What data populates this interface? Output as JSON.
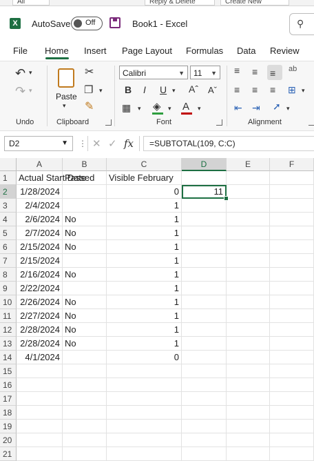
{
  "top_tabs": [
    "All",
    "Reply & Delete",
    "Create New"
  ],
  "title_bar": {
    "autosave_label": "AutoSave",
    "autosave_state": "Off",
    "document_title": "Book1  -  Excel"
  },
  "menu": [
    "File",
    "Home",
    "Insert",
    "Page Layout",
    "Formulas",
    "Data",
    "Review"
  ],
  "ribbon": {
    "groups": [
      "Undo",
      "Clipboard",
      "Font",
      "Alignment"
    ],
    "paste_label": "Paste",
    "font_name": "Calibri",
    "font_size": "11"
  },
  "formula_bar": {
    "name_box": "D2",
    "fx": "fx",
    "formula": "=SUBTOTAL(109, C:C)"
  },
  "grid": {
    "columns": [
      "A",
      "B",
      "C",
      "D",
      "E",
      "F"
    ],
    "rows": [
      "1",
      "2",
      "3",
      "4",
      "5",
      "6",
      "7",
      "8",
      "9",
      "10",
      "11",
      "12",
      "13",
      "14",
      "15",
      "16",
      "17",
      "18",
      "19",
      "20",
      "21"
    ],
    "selected_cell": "D2",
    "cells": [
      [
        "Actual Start Date",
        "Passed",
        "Visible February",
        ""
      ],
      [
        "1/28/2024",
        "",
        "0",
        "11"
      ],
      [
        "2/4/2024",
        "",
        "1",
        ""
      ],
      [
        "2/6/2024",
        "No",
        "1",
        ""
      ],
      [
        "2/7/2024",
        "No",
        "1",
        ""
      ],
      [
        "2/15/2024",
        "No",
        "1",
        ""
      ],
      [
        "2/15/2024",
        "",
        "1",
        ""
      ],
      [
        "2/16/2024",
        "No",
        "1",
        ""
      ],
      [
        "2/22/2024",
        "",
        "1",
        ""
      ],
      [
        "2/26/2024",
        "No",
        "1",
        ""
      ],
      [
        "2/27/2024",
        "No",
        "1",
        ""
      ],
      [
        "2/28/2024",
        "No",
        "1",
        ""
      ],
      [
        "2/28/2024",
        "No",
        "1",
        ""
      ],
      [
        "4/1/2024",
        "",
        "0",
        ""
      ]
    ]
  },
  "colors": {
    "accent": "#1d6f42",
    "grid_line": "#e2e2e2",
    "header_bg": "#f2f2f2"
  }
}
